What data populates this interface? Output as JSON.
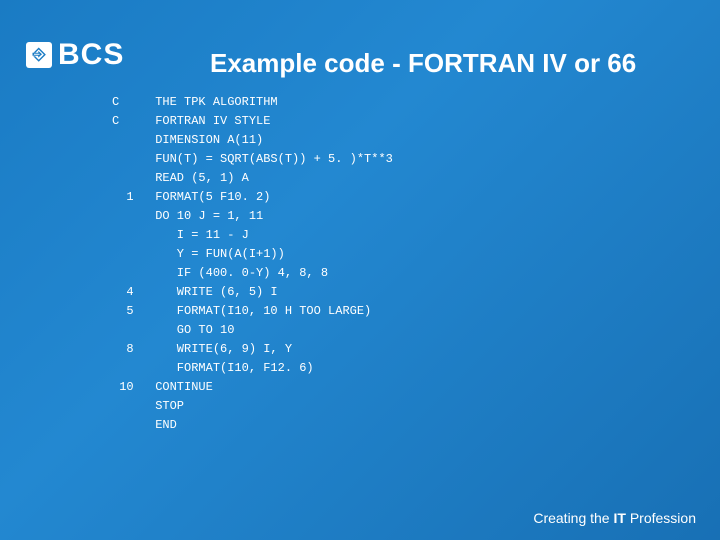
{
  "logo": {
    "badge_glyph": "⎆",
    "text": "BCS"
  },
  "title": "Example code - FORTRAN IV or 66",
  "code_lines": [
    {
      "label": "C",
      "text": "THE TPK ALGORITHM"
    },
    {
      "label": "C",
      "text": "FORTRAN IV STYLE"
    },
    {
      "label": "",
      "text": "DIMENSION A(11)"
    },
    {
      "label": "",
      "text": "FUN(T) = SQRT(ABS(T)) + 5. )*T**3"
    },
    {
      "label": "",
      "text": "READ (5, 1) A"
    },
    {
      "label": "  1",
      "text": "FORMAT(5 F10. 2)"
    },
    {
      "label": "",
      "text": "DO 10 J = 1, 11"
    },
    {
      "label": "",
      "text": "   I = 11 - J"
    },
    {
      "label": "",
      "text": "   Y = FUN(A(I+1))"
    },
    {
      "label": "",
      "text": "   IF (400. 0-Y) 4, 8, 8"
    },
    {
      "label": "  4",
      "text": "   WRITE (6, 5) I"
    },
    {
      "label": "  5",
      "text": "   FORMAT(I10, 10 H TOO LARGE)"
    },
    {
      "label": "",
      "text": "   GO TO 10"
    },
    {
      "label": "  8",
      "text": "   WRITE(6, 9) I, Y"
    },
    {
      "label": "",
      "text": "   FORMAT(I10, F12. 6)"
    },
    {
      "label": " 10",
      "text": "CONTINUE"
    },
    {
      "label": "",
      "text": "STOP"
    },
    {
      "label": "",
      "text": "END"
    }
  ],
  "footer": {
    "prefix": "Creating the ",
    "bold": "IT",
    "suffix": " Profession"
  }
}
